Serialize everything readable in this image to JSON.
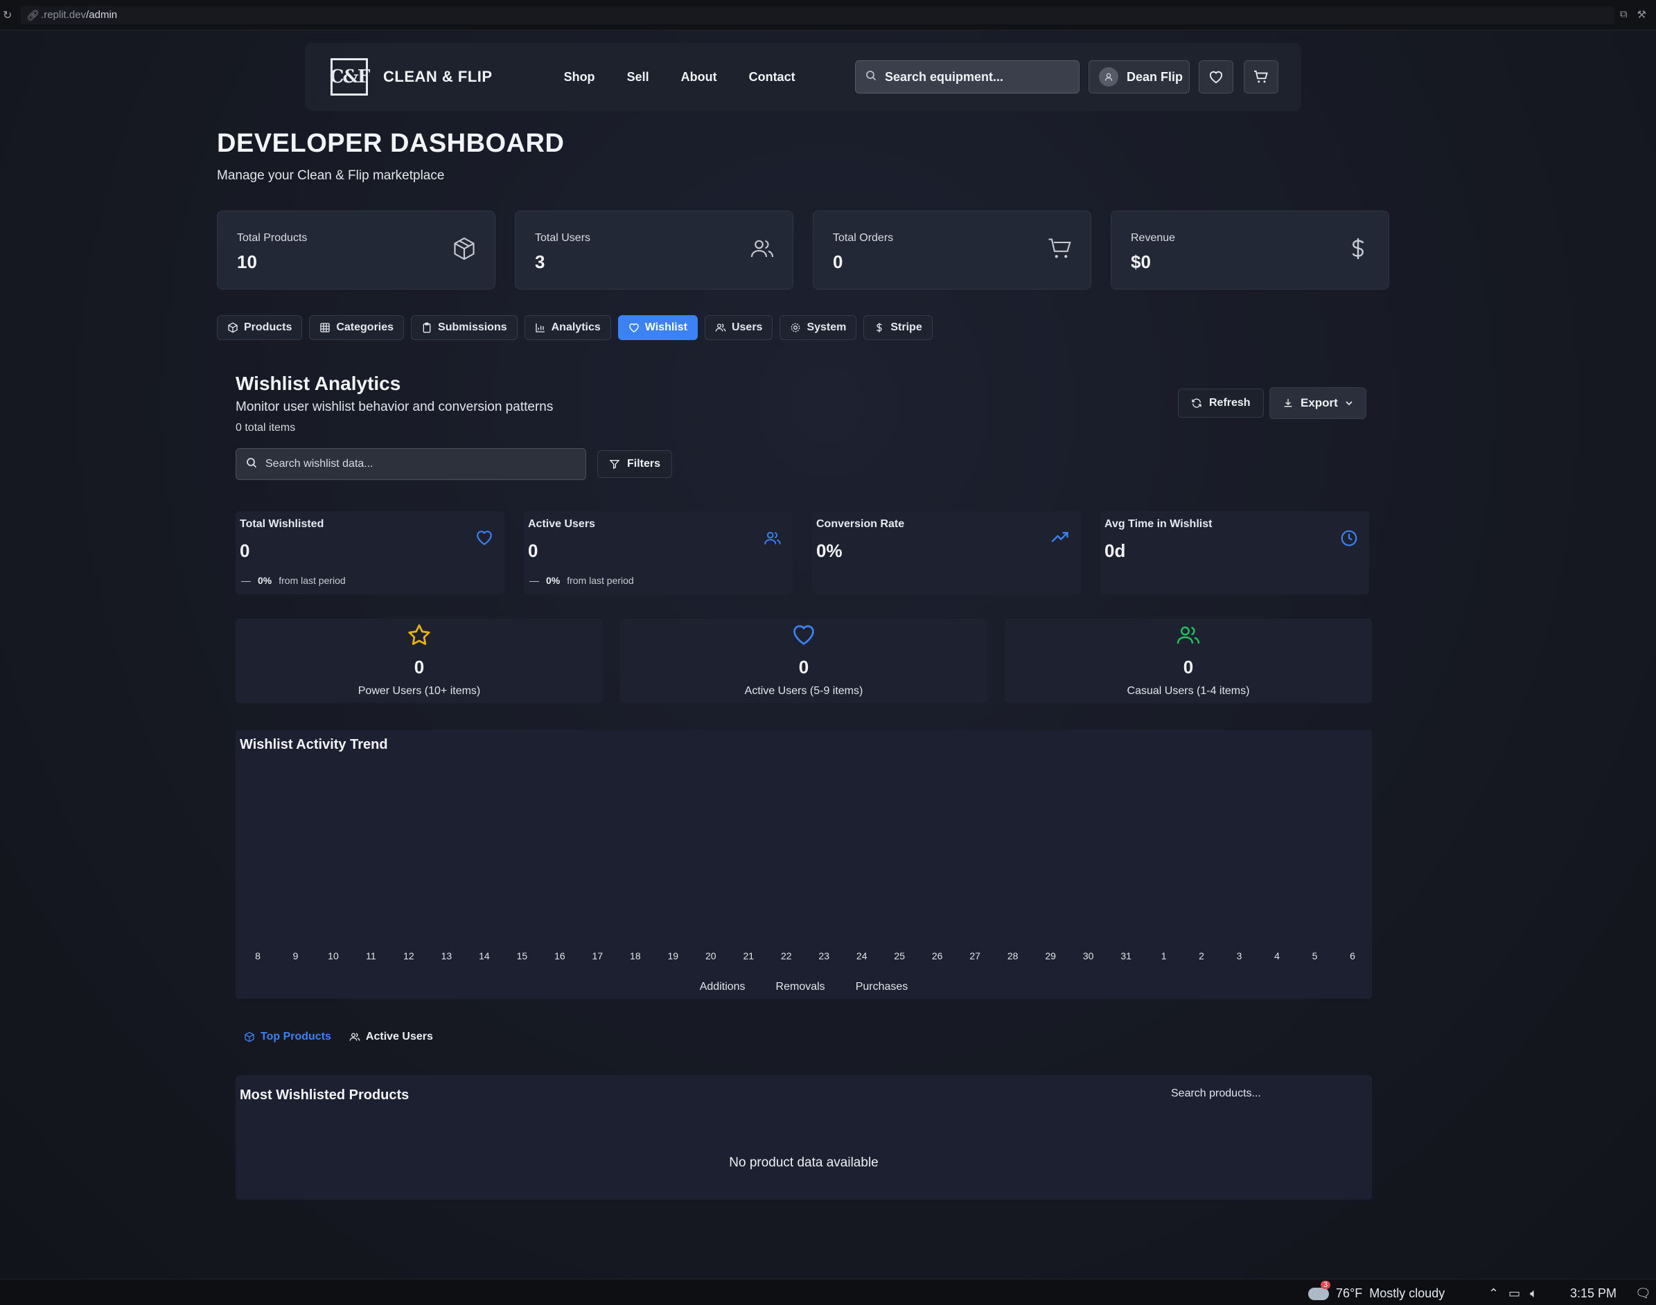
{
  "browser": {
    "url_prefix": ".replit.dev",
    "url_path": "/admin"
  },
  "nav": {
    "logo": "C&F",
    "brand": "CLEAN & FLIP",
    "links": [
      "Shop",
      "Sell",
      "About",
      "Contact"
    ],
    "search_placeholder": "Search equipment...",
    "user_name": "Dean Flip"
  },
  "page": {
    "title": "DEVELOPER DASHBOARD",
    "subtitle": "Manage your Clean & Flip marketplace"
  },
  "stats": [
    {
      "label": "Total Products",
      "value": "10",
      "icon": "box-icon"
    },
    {
      "label": "Total Users",
      "value": "3",
      "icon": "users-icon"
    },
    {
      "label": "Total Orders",
      "value": "0",
      "icon": "cart-icon"
    },
    {
      "label": "Revenue",
      "value": "$0",
      "icon": "dollar-icon"
    }
  ],
  "tabs": [
    {
      "label": "Products",
      "active": false
    },
    {
      "label": "Categories",
      "active": false
    },
    {
      "label": "Submissions",
      "active": false
    },
    {
      "label": "Analytics",
      "active": false
    },
    {
      "label": "Wishlist",
      "active": true
    },
    {
      "label": "Users",
      "active": false
    },
    {
      "label": "System",
      "active": false
    },
    {
      "label": "Stripe",
      "active": false
    }
  ],
  "wishlist": {
    "title": "Wishlist Analytics",
    "subtitle": "Monitor user wishlist behavior and conversion patterns",
    "count": "0 total items",
    "refresh_label": "Refresh",
    "export_label": "Export",
    "search_placeholder": "Search wishlist data...",
    "filters_label": "Filters",
    "kpis": [
      {
        "label": "Total Wishlisted",
        "value": "0",
        "change": "0%",
        "change_text": "from last period"
      },
      {
        "label": "Active Users",
        "value": "0",
        "change": "0%",
        "change_text": "from last period"
      },
      {
        "label": "Conversion Rate",
        "value": "0%"
      },
      {
        "label": "Avg Time in Wishlist",
        "value": "0d"
      }
    ],
    "segments": [
      {
        "value": "0",
        "label": "Power Users (10+ items)"
      },
      {
        "value": "0",
        "label": "Active Users (5-9 items)"
      },
      {
        "value": "0",
        "label": "Casual Users (1-4 items)"
      }
    ],
    "subtabs": [
      "Top Products",
      "Active Users"
    ],
    "products_title": "Most Wishlisted Products",
    "products_search": "Search products...",
    "products_empty": "No product data available"
  },
  "chart_data": {
    "type": "line",
    "title": "Wishlist Activity Trend",
    "categories": [
      "8",
      "9",
      "10",
      "11",
      "12",
      "13",
      "14",
      "15",
      "16",
      "17",
      "18",
      "19",
      "20",
      "21",
      "22",
      "23",
      "24",
      "25",
      "26",
      "27",
      "28",
      "29",
      "30",
      "31",
      "1",
      "2",
      "3",
      "4",
      "5",
      "6"
    ],
    "series": [
      {
        "name": "Additions",
        "values": []
      },
      {
        "name": "Removals",
        "values": []
      },
      {
        "name": "Purchases",
        "values": []
      }
    ],
    "legend": "bottom"
  },
  "taskbar": {
    "temperature": "76°F",
    "weather": "Mostly cloudy",
    "badge": "3",
    "time": "3:15 PM"
  }
}
